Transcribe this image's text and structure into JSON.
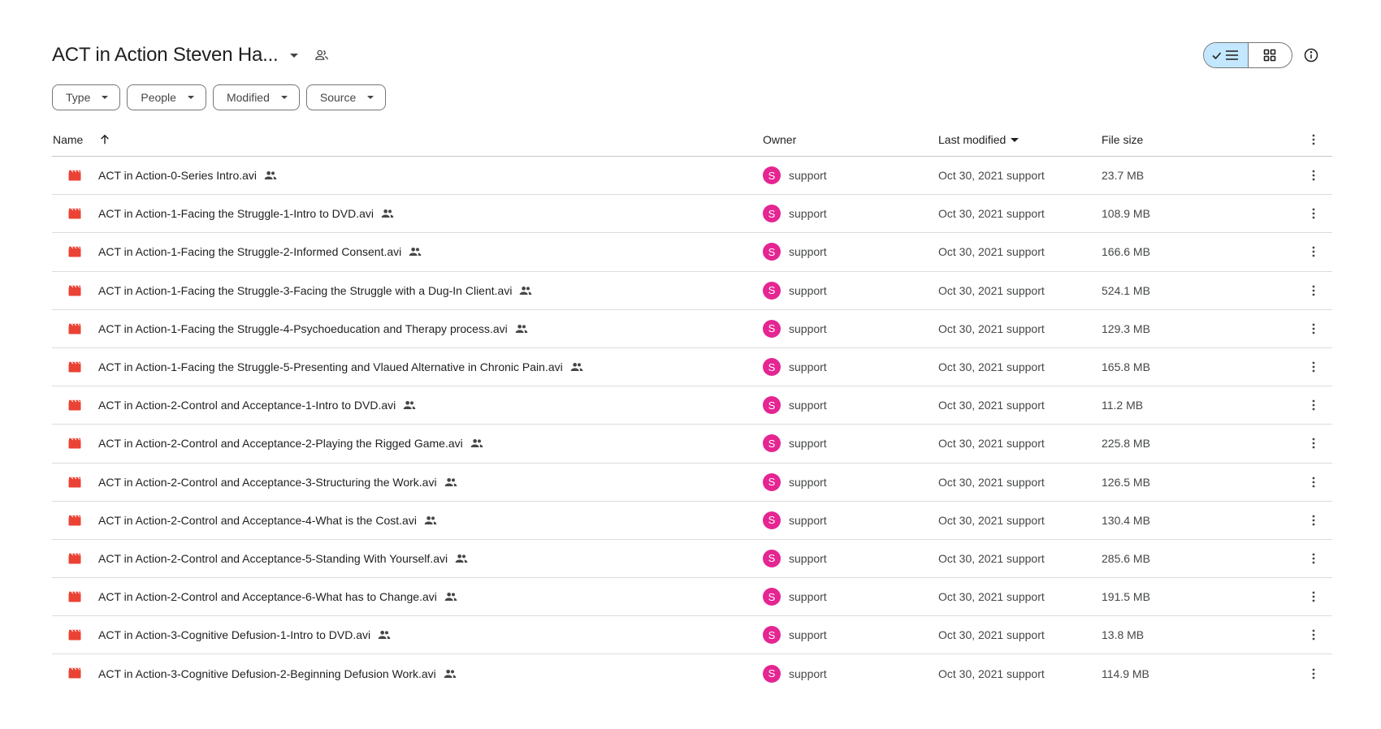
{
  "header": {
    "title": "ACT in Action Steven Ha...",
    "icons": {
      "caret": "dropdown-caret-icon",
      "shared": "shared-folder-icon",
      "info": "info-icon"
    }
  },
  "view_toggle": {
    "active": "list",
    "list_icon": "check-list-icon",
    "grid_icon": "grid-icon"
  },
  "filters": [
    {
      "label": "Type"
    },
    {
      "label": "People"
    },
    {
      "label": "Modified"
    },
    {
      "label": "Source"
    }
  ],
  "columns": {
    "name": "Name",
    "owner": "Owner",
    "last_modified": "Last modified",
    "file_size": "File size"
  },
  "colors": {
    "accent": "#c2e7ff",
    "avatar": "#e52592",
    "video_icon": "#ea4335"
  },
  "files": [
    {
      "name": "ACT in Action-0-Series Intro.avi",
      "owner": "support",
      "owner_initial": "S",
      "modified": "Oct 30, 2021 support",
      "size": "23.7 MB"
    },
    {
      "name": "ACT in Action-1-Facing the Struggle-1-Intro to DVD.avi",
      "owner": "support",
      "owner_initial": "S",
      "modified": "Oct 30, 2021 support",
      "size": "108.9 MB"
    },
    {
      "name": "ACT in Action-1-Facing the Struggle-2-Informed Consent.avi",
      "owner": "support",
      "owner_initial": "S",
      "modified": "Oct 30, 2021 support",
      "size": "166.6 MB"
    },
    {
      "name": "ACT in Action-1-Facing the Struggle-3-Facing the Struggle with a Dug-In Client.avi",
      "owner": "support",
      "owner_initial": "S",
      "modified": "Oct 30, 2021 support",
      "size": "524.1 MB"
    },
    {
      "name": "ACT in Action-1-Facing the Struggle-4-Psychoeducation and Therapy process.avi",
      "owner": "support",
      "owner_initial": "S",
      "modified": "Oct 30, 2021 support",
      "size": "129.3 MB"
    },
    {
      "name": "ACT in Action-1-Facing the Struggle-5-Presenting and Vlaued Alternative in Chronic Pain.avi",
      "owner": "support",
      "owner_initial": "S",
      "modified": "Oct 30, 2021 support",
      "size": "165.8 MB"
    },
    {
      "name": "ACT in Action-2-Control and Acceptance-1-Intro to DVD.avi",
      "owner": "support",
      "owner_initial": "S",
      "modified": "Oct 30, 2021 support",
      "size": "11.2 MB"
    },
    {
      "name": "ACT in Action-2-Control and Acceptance-2-Playing the Rigged Game.avi",
      "owner": "support",
      "owner_initial": "S",
      "modified": "Oct 30, 2021 support",
      "size": "225.8 MB"
    },
    {
      "name": "ACT in Action-2-Control and Acceptance-3-Structuring the Work.avi",
      "owner": "support",
      "owner_initial": "S",
      "modified": "Oct 30, 2021 support",
      "size": "126.5 MB"
    },
    {
      "name": "ACT in Action-2-Control and Acceptance-4-What is the Cost.avi",
      "owner": "support",
      "owner_initial": "S",
      "modified": "Oct 30, 2021 support",
      "size": "130.4 MB"
    },
    {
      "name": "ACT in Action-2-Control and Acceptance-5-Standing With Yourself.avi",
      "owner": "support",
      "owner_initial": "S",
      "modified": "Oct 30, 2021 support",
      "size": "285.6 MB"
    },
    {
      "name": "ACT in Action-2-Control and Acceptance-6-What has to Change.avi",
      "owner": "support",
      "owner_initial": "S",
      "modified": "Oct 30, 2021 support",
      "size": "191.5 MB"
    },
    {
      "name": "ACT in Action-3-Cognitive Defusion-1-Intro to DVD.avi",
      "owner": "support",
      "owner_initial": "S",
      "modified": "Oct 30, 2021 support",
      "size": "13.8 MB"
    },
    {
      "name": "ACT in Action-3-Cognitive Defusion-2-Beginning Defusion Work.avi",
      "owner": "support",
      "owner_initial": "S",
      "modified": "Oct 30, 2021 support",
      "size": "114.9 MB"
    }
  ]
}
